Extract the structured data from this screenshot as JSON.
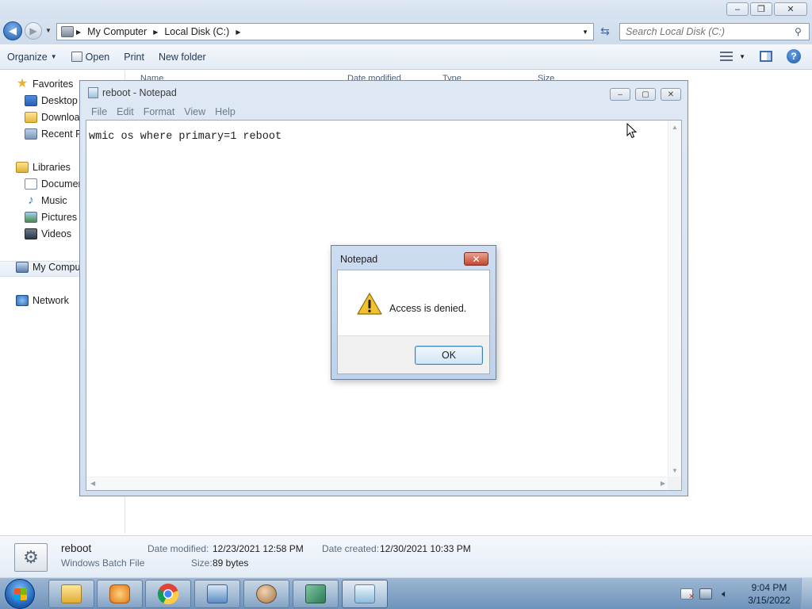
{
  "explorer": {
    "breadcrumbs": [
      "My Computer",
      "Local Disk (C:)"
    ],
    "search_placeholder": "Search Local Disk (C:)",
    "toolbar": {
      "organize": "Organize",
      "open": "Open",
      "print": "Print",
      "new_folder": "New folder"
    },
    "columns": [
      "Name",
      "Date modified",
      "Type",
      "Size"
    ],
    "nav": {
      "favorites": "Favorites",
      "desktop": "Desktop",
      "downloads": "Downloads",
      "recent": "Recent Places",
      "libraries": "Libraries",
      "documents": "Documents",
      "music": "Music",
      "pictures": "Pictures",
      "videos": "Videos",
      "computer": "My Computer",
      "network": "Network"
    },
    "details": {
      "name": "reboot",
      "type": "Windows Batch File",
      "date_modified_label": "Date modified:",
      "date_modified": "12/23/2021 12:58 PM",
      "date_created_label": "Date created:",
      "date_created": "12/30/2021 10:33 PM",
      "size_label": "Size:",
      "size": "89 bytes"
    }
  },
  "notepad": {
    "title": "reboot - Notepad",
    "menu": [
      "File",
      "Edit",
      "Format",
      "View",
      "Help"
    ],
    "content": "wmic os where primary=1 reboot"
  },
  "dialog": {
    "title": "Notepad",
    "message": "Access is denied.",
    "ok_label": "OK",
    "close_glyph": "✕"
  },
  "taskbar": {
    "apps": [
      "explorer-icon",
      "media-player-icon",
      "chrome-icon",
      "control-panel-icon",
      "users-icon",
      "network-icon",
      "notepad-icon"
    ],
    "time": "9:04 PM",
    "date": "3/15/2022"
  },
  "colors": {
    "accent": "#1f62b8",
    "dialog_close": "#c4462e",
    "warning": "#f4c12e"
  }
}
